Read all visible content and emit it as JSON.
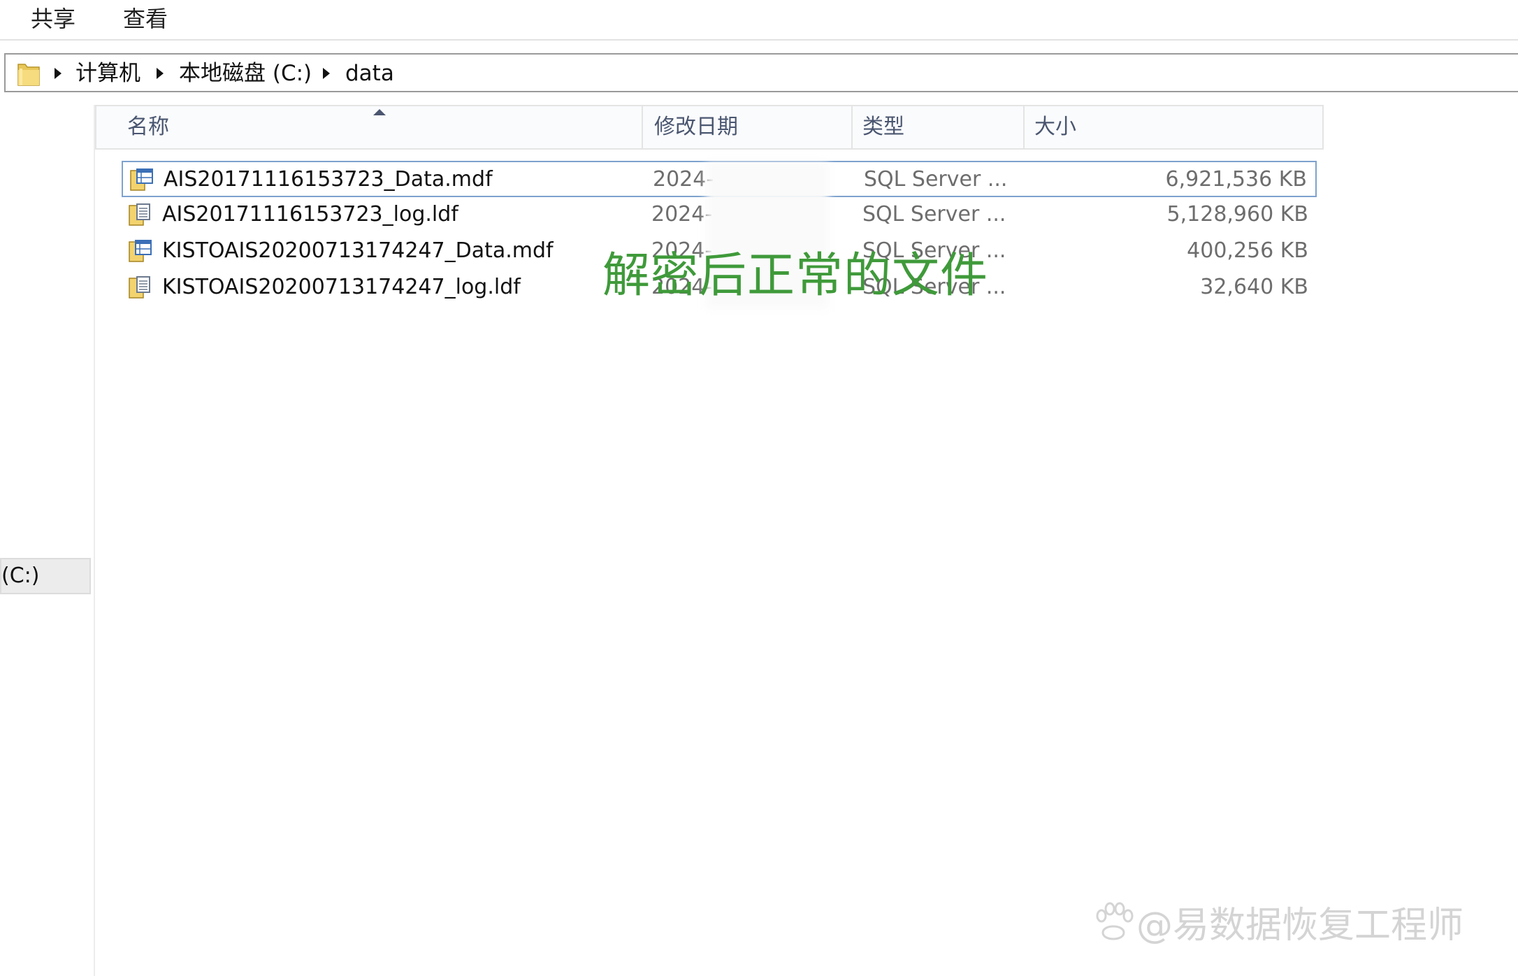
{
  "ribbon": {
    "tabs": [
      "共享",
      "查看"
    ]
  },
  "address_bar": {
    "crumbs": [
      "计算机",
      "本地磁盘 (C:)",
      "data"
    ]
  },
  "nav_pane": {
    "selected_item": "(C:)"
  },
  "columns": {
    "name": "名称",
    "date": "修改日期",
    "type": "类型",
    "size": "大小"
  },
  "files": [
    {
      "name": "AIS20171116153723_Data.mdf",
      "date": "2024-",
      "type": "SQL Server ...",
      "size": "6,921,536 KB",
      "icon": "database-data-file-icon"
    },
    {
      "name": "AIS20171116153723_log.ldf",
      "date": "2024-",
      "type": "SQL Server ...",
      "size": "5,128,960 KB",
      "icon": "database-log-file-icon"
    },
    {
      "name": "KISTOAIS20200713174247_Data.mdf",
      "date": "2024-",
      "type": "SQL Server ...",
      "size": "400,256 KB",
      "icon": "database-data-file-icon"
    },
    {
      "name": "KISTOAIS20200713174247_log.ldf",
      "date": "2024-",
      "type": "SQL Server ...",
      "size": "32,640 KB",
      "icon": "database-log-file-icon"
    }
  ],
  "overlay_caption": "解密后正常的文件",
  "watermark": "@易数据恢复工程师",
  "colors": {
    "caption": "#3f9a3a",
    "selection_border": "#7da2ce",
    "header_text": "#4a5670"
  }
}
